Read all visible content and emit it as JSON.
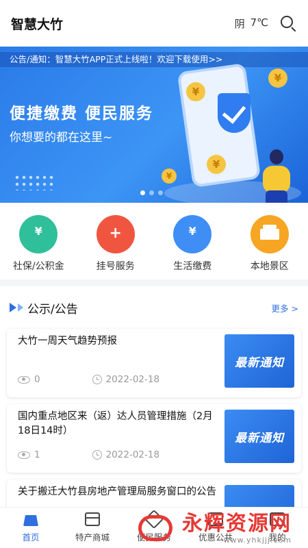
{
  "header": {
    "title": "智慧大竹",
    "weather": "阴",
    "temperature": "7℃"
  },
  "banner": {
    "notice": "公告/通知：智慧大竹APP正式上线啦！欢迎下载使用>>",
    "headline": "便捷缴费  便民服务",
    "subline": "你想要的都在这里~",
    "coin_symbol": "¥",
    "page_count": 3,
    "active_page": 1
  },
  "services": [
    {
      "label": "社保/公积金",
      "icon": "social-security-icon",
      "color": "#2fbf9a",
      "glyph": "¥"
    },
    {
      "label": "挂号服务",
      "icon": "registration-icon",
      "color": "#f0563f",
      "glyph": "+"
    },
    {
      "label": "生活缴费",
      "icon": "utility-payment-icon",
      "color": "#3f8ef6",
      "glyph": "¥"
    },
    {
      "label": "本地景区",
      "icon": "scenic-spot-icon",
      "color": "#f6a623",
      "glyph": ""
    }
  ],
  "notices_section": {
    "title": "公示/公告",
    "more_label": "更多 >",
    "items": [
      {
        "title": "大竹一周天气趋势预报",
        "views": "0",
        "date": "2022-02-18",
        "thumb_text": "最新通知"
      },
      {
        "title": "国内重点地区来（返）达人员管理措施（2月18日14时）",
        "views": "1",
        "date": "2022-02-18",
        "thumb_text": "最新通知"
      },
      {
        "title": "关于搬迁大竹县房地产管理局服务窗口的公告",
        "views": "",
        "date": "",
        "thumb_text": ""
      }
    ]
  },
  "tabbar": {
    "tabs": [
      {
        "label": "首页",
        "icon": "home-icon",
        "active": true
      },
      {
        "label": "特产商城",
        "icon": "shop-icon",
        "active": false
      },
      {
        "label": "便民服务",
        "icon": "service-icon",
        "active": false
      },
      {
        "label": "优惠公共",
        "icon": "gift-icon",
        "active": false
      },
      {
        "label": "我的",
        "icon": "user-icon",
        "active": false
      }
    ]
  },
  "watermark": {
    "text": "永辉资源网",
    "url": "www.yhkjjj.com"
  }
}
